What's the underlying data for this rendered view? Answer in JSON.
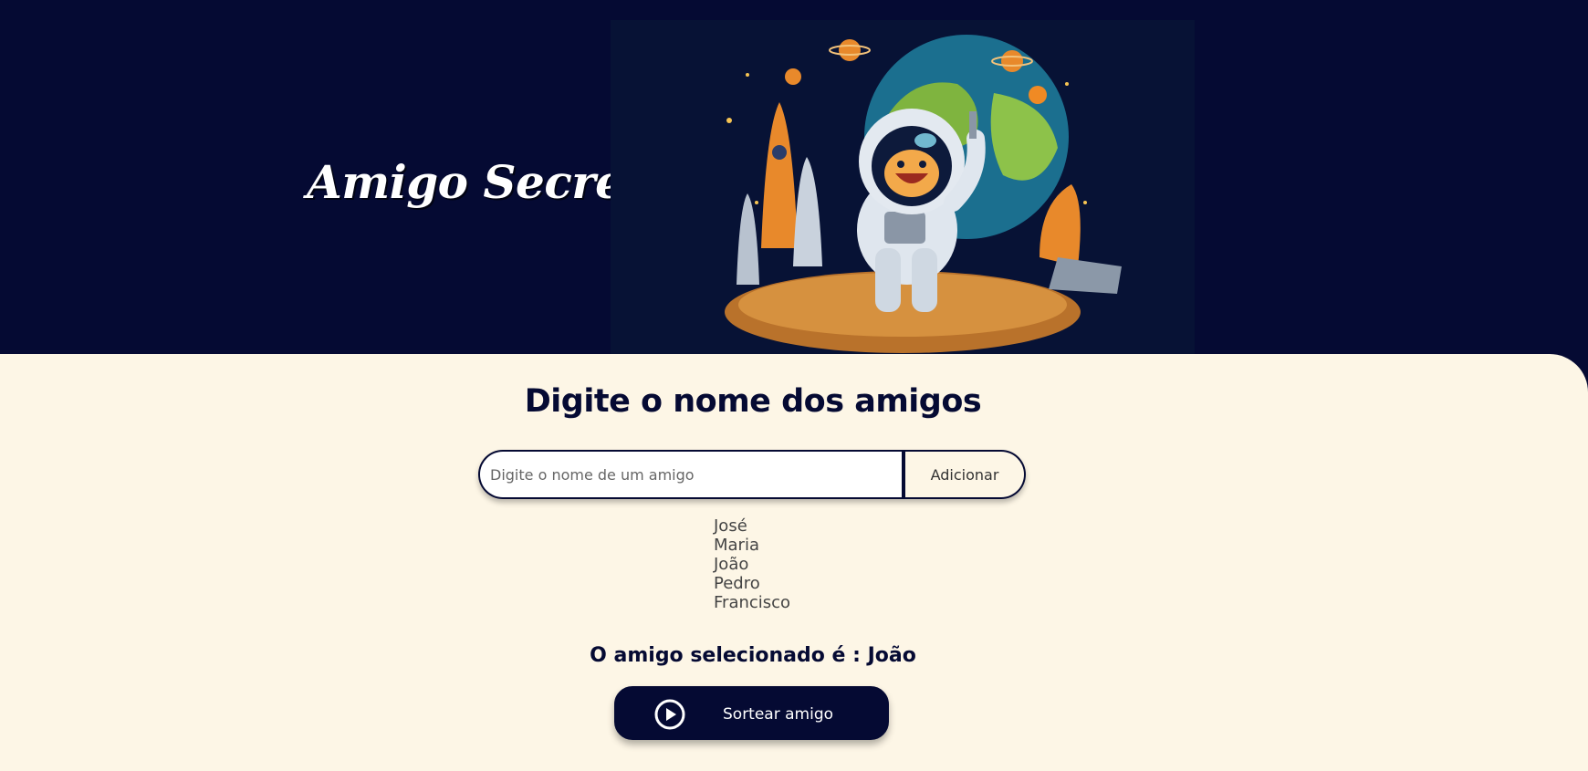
{
  "header": {
    "title": "Amigo Secreto",
    "hero_image": "astronaut-space-illustration"
  },
  "main": {
    "heading": "Digite o nome dos amigos",
    "input": {
      "placeholder": "Digite o nome de um amigo",
      "value": ""
    },
    "add_button_label": "Adicionar",
    "friends": [
      "José",
      "Maria",
      "João",
      "Pedro",
      "Francisco"
    ],
    "result": "O amigo selecionado é : João",
    "draw_button": {
      "label": "Sortear amigo",
      "icon": "play-circle-icon"
    }
  },
  "colors": {
    "navy": "#050a33",
    "cream": "#fdf6e6",
    "white": "#ffffff"
  }
}
